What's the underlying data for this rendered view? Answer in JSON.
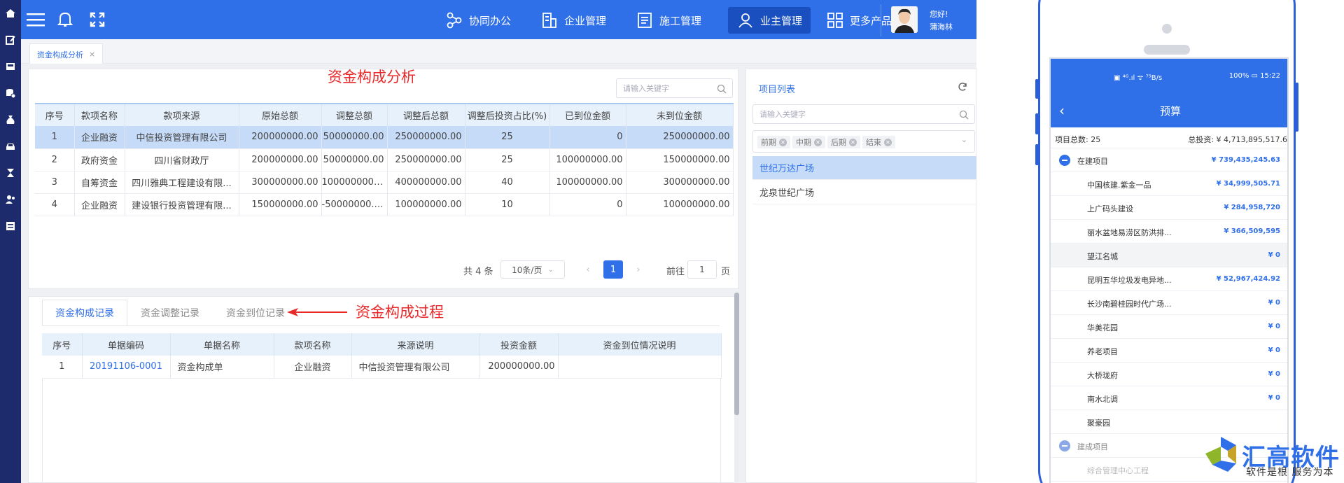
{
  "sidebar": {
    "icons": [
      "home-icon",
      "edit-icon",
      "inbox-icon",
      "database-icon",
      "money-bag-icon",
      "car-icon",
      "hourglass-icon",
      "users-icon",
      "list-icon"
    ]
  },
  "topbar": {
    "nav": [
      {
        "label": "协同办公",
        "icon": "share-icon"
      },
      {
        "label": "企业管理",
        "icon": "building-icon"
      },
      {
        "label": "施工管理",
        "icon": "document-icon"
      },
      {
        "label": "业主管理",
        "icon": "user-icon",
        "active": true
      },
      {
        "label": "更多产品",
        "icon": "grid-icon"
      }
    ],
    "greeting": "您好!",
    "username": "蒲海林"
  },
  "tabs": {
    "open_tab": "资金构成分析",
    "close": "×"
  },
  "annotations": {
    "top": "资金构成分析",
    "bottom": "资金构成过程"
  },
  "funding": {
    "search_placeholder": "请输入关键字",
    "columns": [
      "序号",
      "款项名称",
      "款项来源",
      "原始总额",
      "调整总额",
      "调整后总额",
      "调整后投资占比(%)",
      "已到位金额",
      "未到位金额"
    ],
    "rows": [
      [
        "1",
        "企业融资",
        "中信投资管理有限公司",
        "200000000.00",
        "50000000.00",
        "250000000.00",
        "25",
        "0",
        "250000000.00"
      ],
      [
        "2",
        "政府资金",
        "四川省财政厅",
        "200000000.00",
        "50000000.00",
        "250000000.00",
        "25",
        "100000000.00",
        "150000000.00"
      ],
      [
        "3",
        "自筹资金",
        "四川雅典工程建设有限...",
        "300000000.00",
        "100000000.00",
        "400000000.00",
        "40",
        "100000000.00",
        "300000000.00"
      ],
      [
        "4",
        "企业融资",
        "建设银行投资管理有限...",
        "150000000.00",
        "-50000000.00",
        "100000000.00",
        "10",
        "0",
        "100000000.00"
      ]
    ],
    "pager": {
      "total": "共 4 条",
      "page_size": "10条/页",
      "current": "1",
      "goto_prefix": "前往",
      "goto_value": "1",
      "goto_suffix": "页",
      "prev": "‹",
      "next": "›"
    }
  },
  "records": {
    "tabs": [
      "资金构成记录",
      "资金调整记录",
      "资金到位记录"
    ],
    "columns": [
      "序号",
      "单据编码",
      "单据名称",
      "款项名称",
      "来源说明",
      "投资金额",
      "资金到位情况说明"
    ],
    "rows": [
      [
        "1",
        "20191106-0001",
        "资金构成单",
        "企业融资",
        "中信投资管理有限公司",
        "200000000.00",
        ""
      ]
    ]
  },
  "projects": {
    "title": "项目列表",
    "search_placeholder": "请输入关键字",
    "tags": [
      "前期",
      "中期",
      "后期",
      "结束"
    ],
    "items": [
      "世纪万达广场",
      "龙泉世纪广场"
    ]
  },
  "phone": {
    "status_left": "▣ ⁴ᴳ.ıl ᯤ ⁷⁵B/s",
    "status_right": "100% ▭ 15:22",
    "title": "预算",
    "back": "‹",
    "summary_left": "项目总数: 25",
    "summary_right": "总投资: ¥ 4,713,895,517.6",
    "group1": {
      "label": "在建项目",
      "amount": "¥ 739,435,245.63"
    },
    "items": [
      {
        "name": "中国核建.紫金一品",
        "amount": "¥ 34,999,505.71"
      },
      {
        "name": "上广码头建设",
        "amount": "¥ 284,958,720"
      },
      {
        "name": "丽水盆地易涝区防洪排...",
        "amount": "¥ 366,509,595"
      },
      {
        "name": "望江名城",
        "amount": "¥ 0"
      },
      {
        "name": "昆明五华垃圾发电异地...",
        "amount": "¥ 52,967,424.92"
      },
      {
        "name": "长沙南碧桂园时代广场...",
        "amount": "¥ 0"
      },
      {
        "name": "华美花园",
        "amount": "¥ 0"
      },
      {
        "name": "养老项目",
        "amount": "¥ 0"
      },
      {
        "name": "大桥珑府",
        "amount": "¥ 0"
      },
      {
        "name": "南水北调",
        "amount": "¥ 0"
      },
      {
        "name": "聚豪园",
        "amount": ""
      }
    ],
    "group2": {
      "label": "建成项目"
    },
    "last_item": "综合管理中心工程"
  },
  "brand": {
    "name": "汇高软件",
    "tagline": "软件是根  服务为本"
  },
  "colors": {
    "primary": "#2f6fe8",
    "sidebar": "#1d2a6b",
    "selected_row": "#c6dbf8",
    "annotation": "#e8292a"
  }
}
